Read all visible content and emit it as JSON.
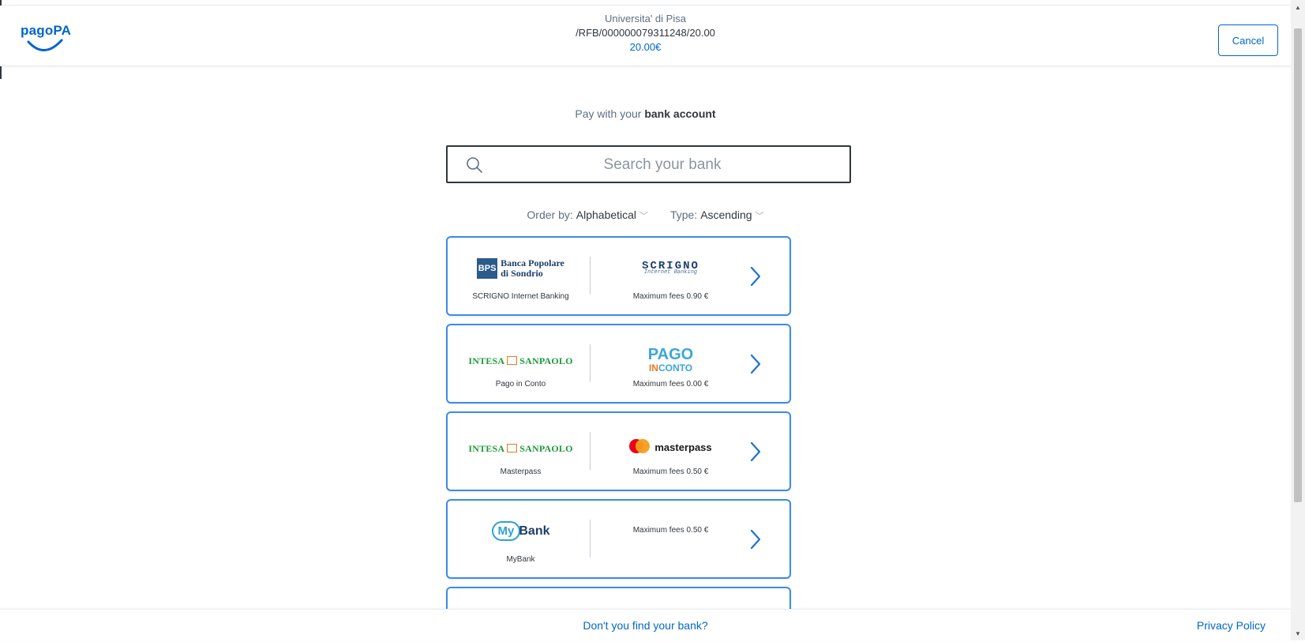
{
  "header": {
    "logo_text": "pagoPA",
    "organization": "Universita' di Pisa",
    "payment_code": "/RFB/000000079311248/20.00",
    "amount": "20.00€",
    "cancel_label": "Cancel"
  },
  "main": {
    "subtitle_prefix": "Pay with your",
    "subtitle_bold": "bank account",
    "search": {
      "placeholder": "Search your bank",
      "value": ""
    },
    "order": {
      "order_label": "Order by:",
      "order_value": "Alphabetical",
      "type_label": "Type:",
      "type_value": "Ascending"
    },
    "banks": [
      {
        "bank_logo": "Banca Popolare di Sondrio",
        "bank_logo_line1": "Banca Popolare",
        "bank_logo_line2": "di Sondrio",
        "service_logo": "SCRIGNO",
        "service_logo_sub": "Internet Banking",
        "name": "SCRIGNO Internet Banking",
        "fees": "Maximum fees 0.90 €"
      },
      {
        "bank_logo": "INTESA SANPAOLO",
        "bank_logo_a": "INTESA",
        "bank_logo_b": "SANPAOLO",
        "service_logo": "PAGO",
        "service_logo_in": "IN",
        "service_logo_conto": "CONTO",
        "name": "Pago in Conto",
        "fees": "Maximum fees 0.00 €"
      },
      {
        "bank_logo": "INTESA SANPAOLO",
        "bank_logo_a": "INTESA",
        "bank_logo_b": "SANPAOLO",
        "service_logo": "masterpass",
        "name": "Masterpass",
        "fees": "Maximum fees 0.50 €"
      },
      {
        "bank_logo": "MyBank",
        "bank_logo_a": "My",
        "bank_logo_b": "Bank",
        "name": "MyBank",
        "fees": "Maximum fees 0.50 €"
      }
    ]
  },
  "footer": {
    "not_found_link": "Don't you find your bank?",
    "privacy_link": "Privacy Policy"
  },
  "colors": {
    "accent": "#0066cc",
    "card_border": "#3b8be6",
    "text": "#30373d"
  },
  "icons": [
    "search-icon",
    "chevron-right-icon",
    "chevron-down-icon",
    "scroll-up-icon",
    "scroll-down-icon"
  ]
}
